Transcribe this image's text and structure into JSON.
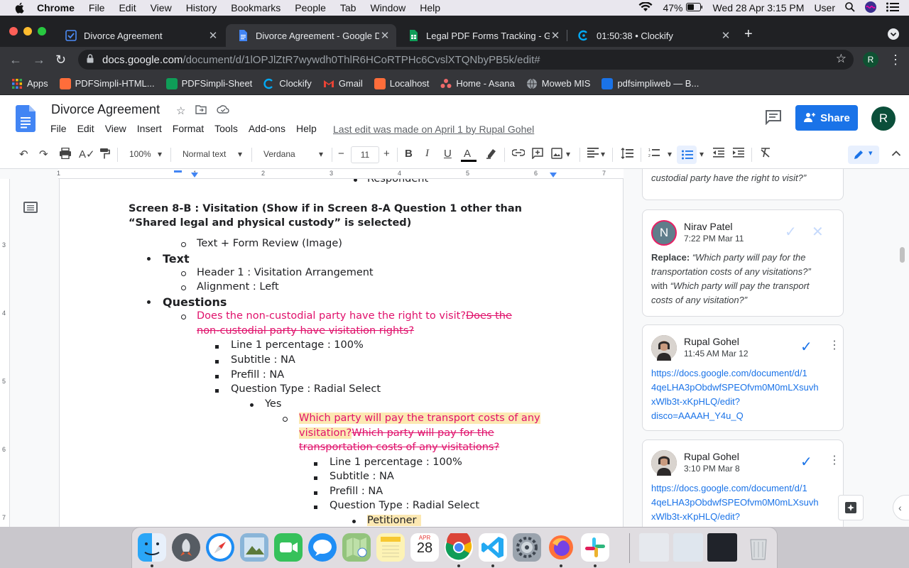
{
  "mac_menubar": {
    "apple_icon": "apple-logo-icon",
    "app_name": "Chrome",
    "items": [
      "File",
      "Edit",
      "View",
      "History",
      "Bookmarks",
      "People",
      "Tab",
      "Window",
      "Help"
    ],
    "battery": "47%",
    "datetime": "Wed 28 Apr  3:15 PM",
    "user": "User"
  },
  "tabs": [
    {
      "title": "Divorce Agreement",
      "icon": "asana-check-icon",
      "color": "#4c8bf5",
      "active": false
    },
    {
      "title": "Divorce Agreement - Google D",
      "icon": "google-docs-icon",
      "color": "#4285f4",
      "active": true
    },
    {
      "title": "Legal PDF Forms Tracking - Go",
      "icon": "google-sheets-icon",
      "color": "#0f9d58",
      "active": false
    },
    {
      "title": "01:50:38 • Clockify",
      "icon": "clockify-icon",
      "color": "#03a9f4",
      "active": false
    }
  ],
  "omnibox": {
    "host": "docs.google.com",
    "path": "/document/d/1lOPJlZtR7wywdh0ThlR6HCoRTPHc6CvslXTQNbyPB5k/edit#",
    "profile_initial": "R"
  },
  "bookmarks": [
    {
      "label": "Apps",
      "color": "#ea4335"
    },
    {
      "label": "PDFSimpli-HTML...",
      "color": "#ff6d3a"
    },
    {
      "label": "PDFSimpli-Sheet",
      "color": "#0f9d58"
    },
    {
      "label": "Clockify",
      "color": "#03a9f4"
    },
    {
      "label": "Gmail",
      "color": "#ea4335"
    },
    {
      "label": "Localhost",
      "color": "#ff6d3a"
    },
    {
      "label": "Home - Asana",
      "color": "#f06a6a"
    },
    {
      "label": "Moweb MIS",
      "color": "#9aa0a6"
    },
    {
      "label": "pdfsimpliweb — B...",
      "color": "#1a73e8"
    }
  ],
  "docs": {
    "title": "Divorce Agreement",
    "menu": [
      "File",
      "Edit",
      "View",
      "Insert",
      "Format",
      "Tools",
      "Add-ons",
      "Help"
    ],
    "last_edit": "Last edit was made on April 1 by Rupal Gohel",
    "share_label": "Share",
    "user_initial": "R"
  },
  "toolbar": {
    "zoom": "100%",
    "style": "Normal text",
    "font": "Verdana",
    "font_size": "11",
    "minus": "−",
    "plus": "+"
  },
  "ruler": {
    "numbers": [
      "1",
      "1",
      "2",
      "3",
      "4",
      "5",
      "6",
      "7"
    ],
    "vnumbers": [
      "3",
      "4",
      "5",
      "6",
      "7"
    ]
  },
  "document": {
    "top_partial": "Respondent",
    "heading_line1": "Screen 8-B :  Visitation (Show if in Screen 8-A Question 1 other than",
    "heading_line2": "“Shared legal and physical custody” is selected)",
    "text_form_review": "Text + Form Review (Image)",
    "text_label": "Text",
    "header_1": "Header 1 : Visitation Arrangement",
    "alignment": "Alignment : Left",
    "questions_label": "Questions",
    "q1_new": "Does the non-custodial party have the right to visit?",
    "q1_old_a": "Does the ",
    "q1_old_b": "non-custodial party have visitation rights?",
    "q1_line1": "Line 1 percentage : 100%",
    "q1_subtitle": "Subtitle : NA",
    "q1_prefill": "Prefill : NA",
    "q1_type": "Question Type : Radial Select",
    "q1_yes": "Yes",
    "q2_new_a": "Which party will pay the transport costs of any",
    "q2_new_b": "visitation?",
    "q2_old_a": "Which party will pay for the ",
    "q2_old_b": "transportation costs of any visitations?",
    "q2_line1": "Line 1 percentage : 100%",
    "q2_subtitle": "Subtitle : NA",
    "q2_prefill": "Prefill : NA",
    "q2_type": "Question Type : Radial Select",
    "q2_petitioner": "Petitioner"
  },
  "comments": {
    "top_partial": "custodial party have the right to visit?”",
    "c1": {
      "name": "Nirav Patel",
      "initial": "N",
      "time": "7:22 PM Mar 11",
      "replace_label": "Replace:",
      "replace_text_a": " “Which party will pay for the",
      "replace_text_b": "transportation costs of any visitations?”",
      "with_label": "with",
      "with_text_a": " “Which party will pay the transport",
      "with_text_b": "costs of any visitation?”"
    },
    "c2": {
      "name": "Rupal Gohel",
      "time": "11:45 AM Mar 12",
      "link_lines": [
        "https://docs.google.com/document/d/1",
        "4qeLHA3pObdwfSPEOfvm0M0mLXsuvh",
        "xWlb3t-xKpHLQ/edit?",
        "disco=AAAAH_Y4u_Q"
      ]
    },
    "c3": {
      "name": "Rupal Gohel",
      "time": "3:10 PM Mar 8",
      "link_lines": [
        "https://docs.google.com/document/d/1",
        "4qeLHA3pObdwfSPEOfvm0M0mLXsuvh",
        "xWlb3t-xKpHLQ/edit?"
      ]
    }
  },
  "dock": {
    "calendar_month": "APR",
    "calendar_day": "28"
  }
}
